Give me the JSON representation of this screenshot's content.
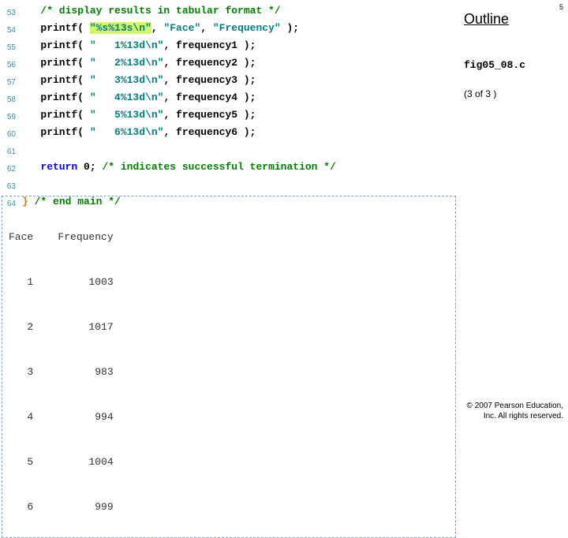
{
  "sidebar": {
    "outline": "Outline",
    "slide_number": "5",
    "filename": "fig05_08.c",
    "page_of": "(3 of 3 )"
  },
  "copyright": {
    "line1": "© 2007 Pearson Education,",
    "line2": "Inc.  All rights reserved."
  },
  "code": {
    "l53": {
      "num": "53",
      "indent": "   ",
      "comment": "/* display results in tabular format */"
    },
    "l54": {
      "num": "54",
      "indent": "   ",
      "fn": "printf( ",
      "str": "\"%s%13s\\n\"",
      "rest": ", ",
      "a1": "\"Face\"",
      "c1": ", ",
      "a2": "\"Frequency\"",
      "tail": " );"
    },
    "l55": {
      "num": "55",
      "indent": "   ",
      "fn": "printf( ",
      "str": "\"   1%13d\\n\"",
      "rest": ", frequency1 );"
    },
    "l56": {
      "num": "56",
      "indent": "   ",
      "fn": "printf( ",
      "str": "\"   2%13d\\n\"",
      "rest": ", frequency2 );"
    },
    "l57": {
      "num": "57",
      "indent": "   ",
      "fn": "printf( ",
      "str": "\"   3%13d\\n\"",
      "rest": ", frequency3 );"
    },
    "l58": {
      "num": "58",
      "indent": "   ",
      "fn": "printf( ",
      "str": "\"   4%13d\\n\"",
      "rest": ", frequency4 );"
    },
    "l59": {
      "num": "59",
      "indent": "   ",
      "fn": "printf( ",
      "str": "\"   5%13d\\n\"",
      "rest": ", frequency5 );"
    },
    "l60": {
      "num": "60",
      "indent": "   ",
      "fn": "printf( ",
      "str": "\"   6%13d\\n\"",
      "rest": ", frequency6 );"
    },
    "l61": {
      "num": "61"
    },
    "l62": {
      "num": "62",
      "indent": "   ",
      "kw": "return",
      "zero": " 0; ",
      "comment": "/* indicates successful termination */"
    },
    "l63": {
      "num": "63"
    },
    "l64": {
      "num": "64",
      "brace": "} ",
      "comment": "/* end main */"
    }
  },
  "output": {
    "header": "Face    Frequency",
    "r1": "   1         1003",
    "r2": "   2         1017",
    "r3": "   3          983",
    "r4": "   4          994",
    "r5": "   5         1004",
    "r6": "   6          999"
  }
}
